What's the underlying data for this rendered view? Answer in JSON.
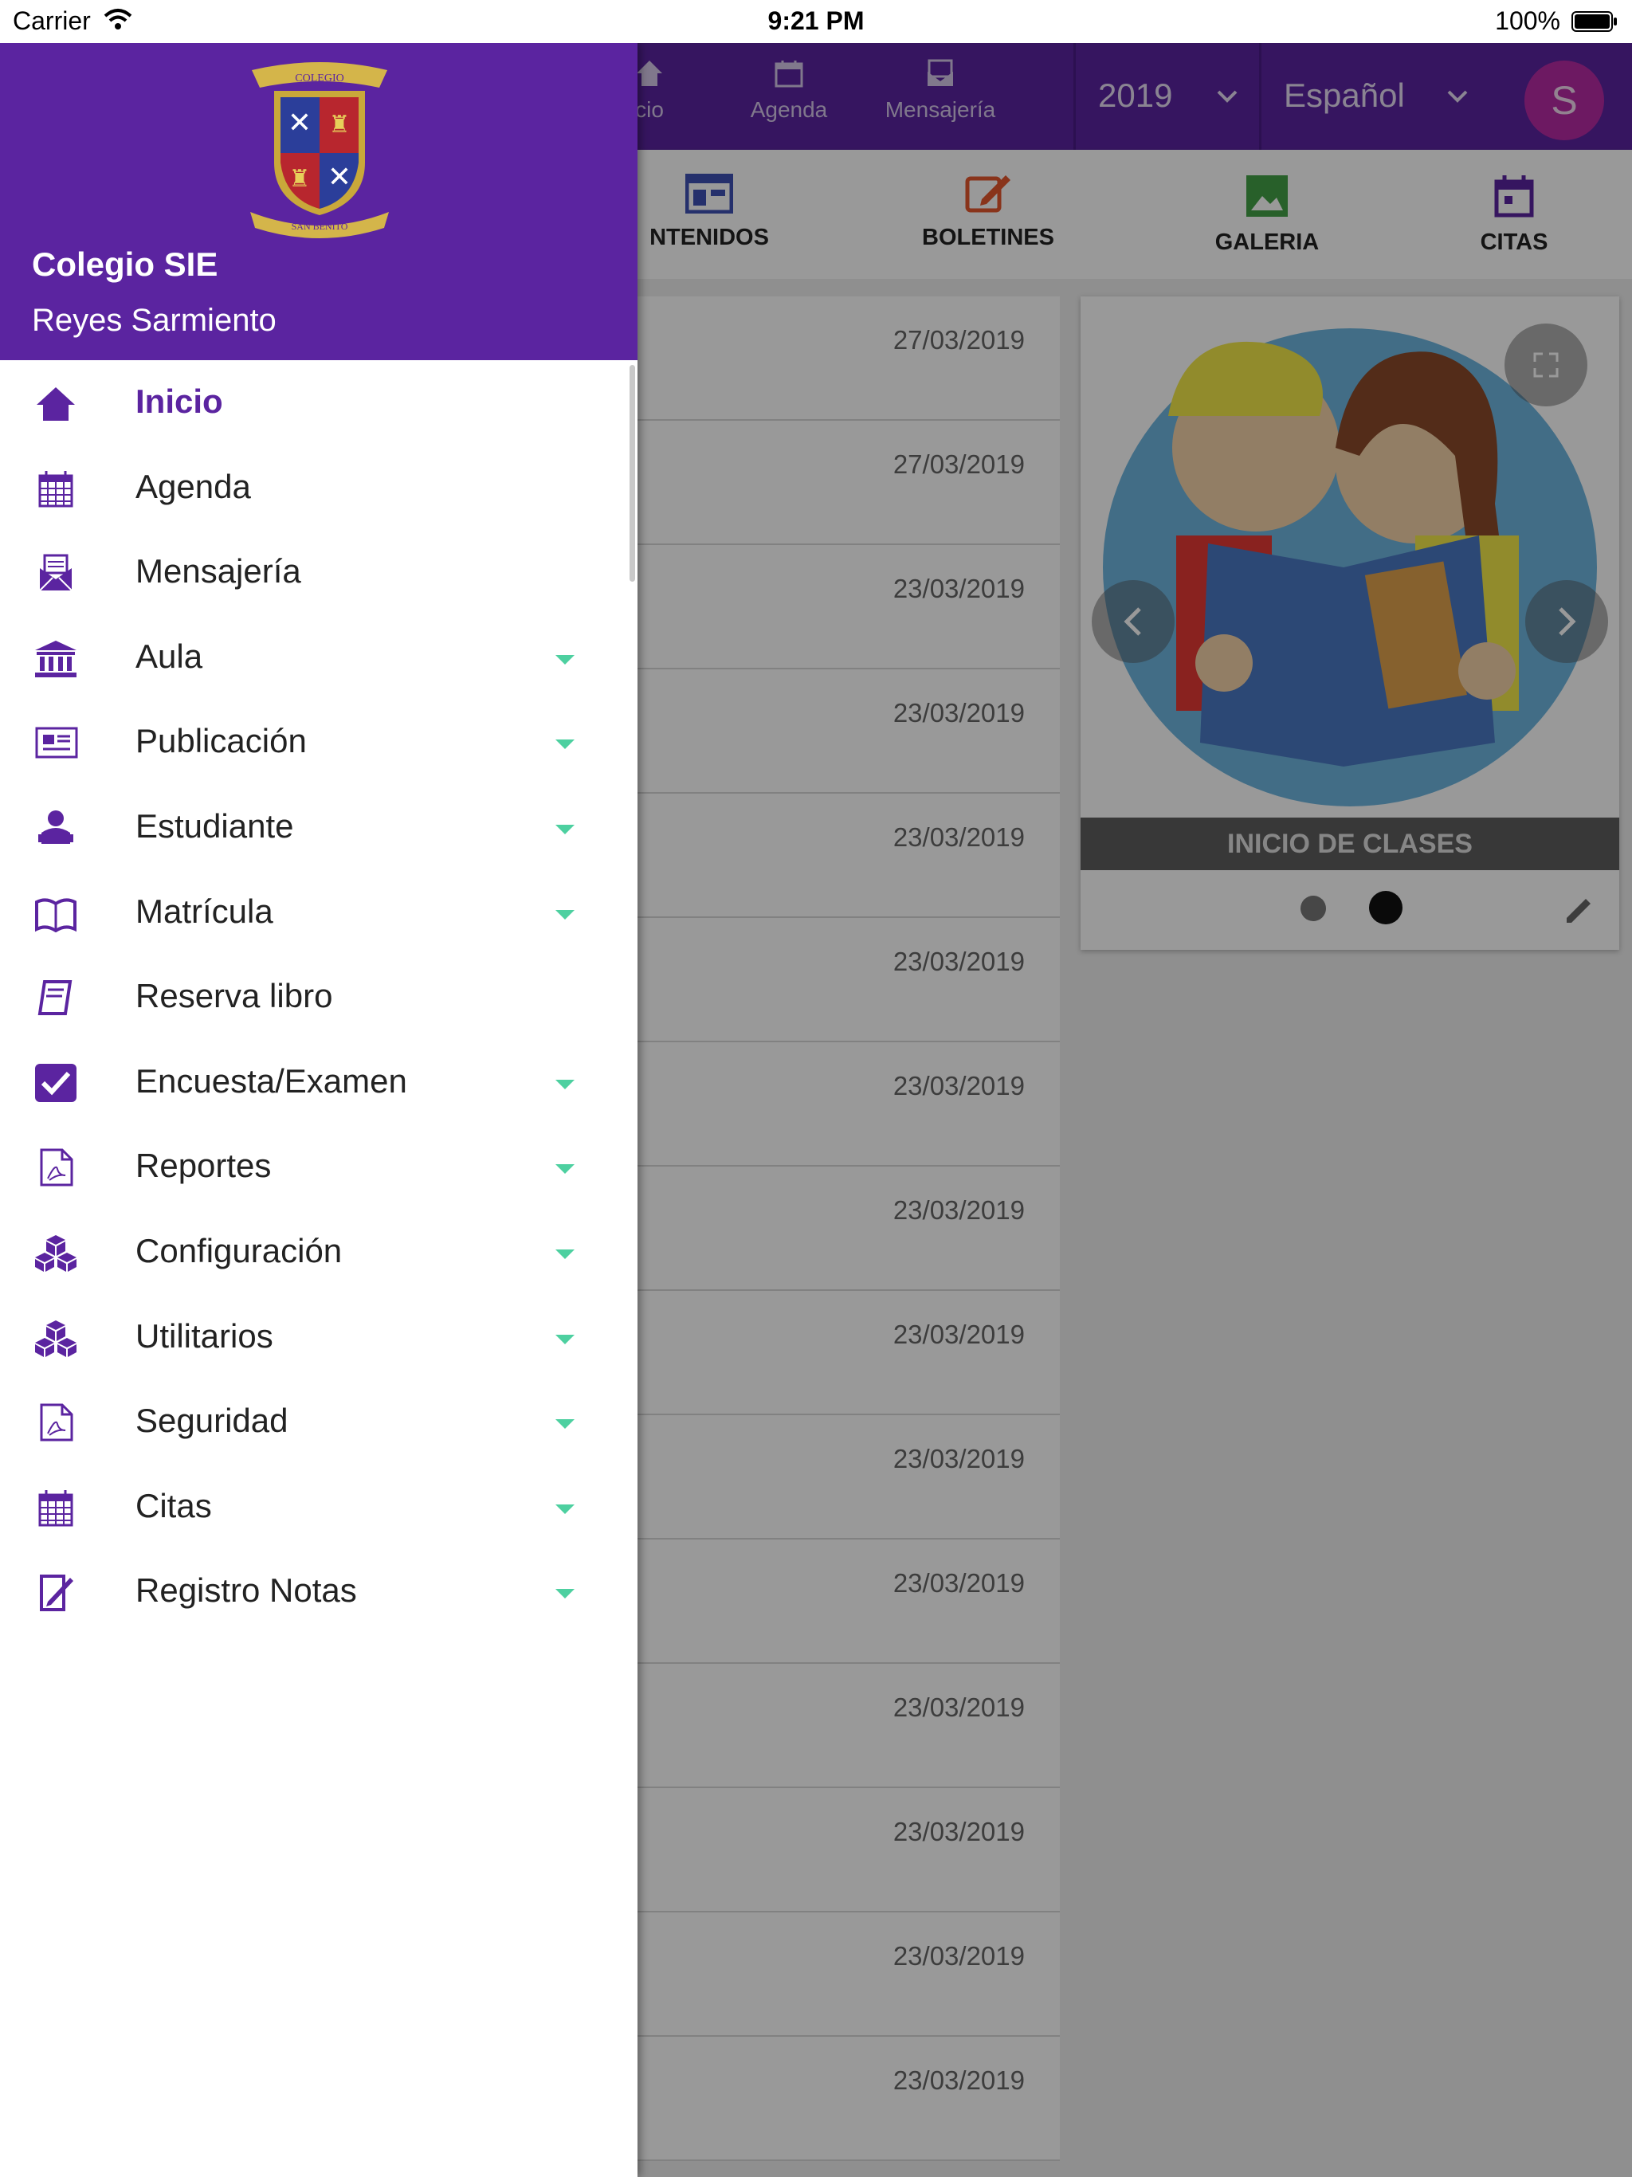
{
  "status_bar": {
    "carrier": "Carrier",
    "time": "9:21 PM",
    "battery": "100%"
  },
  "topbar": {
    "nav": [
      {
        "label": "cio",
        "icon": "home-icon"
      },
      {
        "label": "Agenda",
        "icon": "calendar-icon"
      },
      {
        "label": "Mensajería",
        "icon": "mail-icon"
      }
    ],
    "year": "2019",
    "language": "Español",
    "avatar_letter": "S"
  },
  "section_tabs": [
    {
      "label": "NTENIDOS",
      "icon": "content-icon",
      "color": "#3f51b5"
    },
    {
      "label": "BOLETINES",
      "icon": "edit-icon",
      "color": "#e4572e"
    },
    {
      "label": "GALERIA",
      "icon": "image-icon",
      "color": "#43a047"
    },
    {
      "label": "CITAS",
      "icon": "calendar-icon",
      "color": "#5b24a0"
    }
  ],
  "list_dates": [
    "27/03/2019",
    "27/03/2019",
    "23/03/2019",
    "23/03/2019",
    "23/03/2019",
    "23/03/2019",
    "23/03/2019",
    "23/03/2019",
    "23/03/2019",
    "23/03/2019",
    "23/03/2019",
    "23/03/2019",
    "23/03/2019",
    "23/03/2019",
    "23/03/2019"
  ],
  "gallery": {
    "caption": "INICIO DE CLASES",
    "active_slide": 2,
    "total_slides": 2
  },
  "drawer": {
    "school": "Colegio SIE",
    "user": "Reyes Sarmiento",
    "logo_icon": "school-crest-logo",
    "items": [
      {
        "label": "Inicio",
        "icon": "home-icon",
        "expandable": false,
        "active": true
      },
      {
        "label": "Agenda",
        "icon": "calendar-icon",
        "expandable": false
      },
      {
        "label": "Mensajería",
        "icon": "mail-icon",
        "expandable": false
      },
      {
        "label": "Aula",
        "icon": "institution-icon",
        "expandable": true
      },
      {
        "label": "Publicación",
        "icon": "newspaper-icon",
        "expandable": true
      },
      {
        "label": "Estudiante",
        "icon": "student-icon",
        "expandable": true
      },
      {
        "label": "Matrícula",
        "icon": "book-open-icon",
        "expandable": true
      },
      {
        "label": "Reserva libro",
        "icon": "book-icon",
        "expandable": false
      },
      {
        "label": "Encuesta/Examen",
        "icon": "checkbox-icon",
        "expandable": true
      },
      {
        "label": "Reportes",
        "icon": "pdf-icon",
        "expandable": true
      },
      {
        "label": "Configuración",
        "icon": "cubes-icon",
        "expandable": true
      },
      {
        "label": "Utilitarios",
        "icon": "cubes-icon",
        "expandable": true
      },
      {
        "label": "Seguridad",
        "icon": "pdf-icon",
        "expandable": true
      },
      {
        "label": "Citas",
        "icon": "calendar-icon",
        "expandable": true
      },
      {
        "label": "Registro Notas",
        "icon": "edit-document-icon",
        "expandable": true
      }
    ]
  },
  "colors": {
    "primary": "#5b24a0",
    "accent_arrow": "#4dd0a0",
    "avatar": "#b62aa3"
  }
}
